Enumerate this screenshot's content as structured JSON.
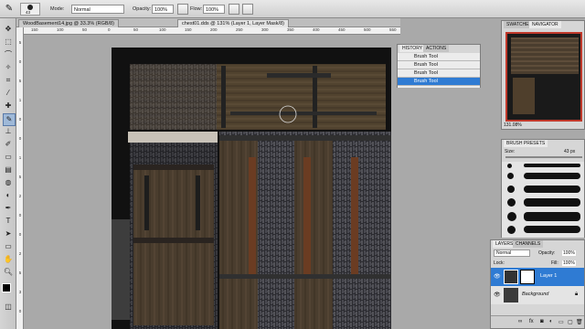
{
  "options": {
    "mode_label": "Mode:",
    "mode_value": "Normal",
    "opacity_label": "Opacity:",
    "opacity_value": "100%",
    "flow_label": "Flow:",
    "flow_value": "100%",
    "brush_size": "43"
  },
  "tabs": [
    {
      "label": "WoodBasement14.jpg @ 33.3% (RGB/8)"
    },
    {
      "label": "chest01.dds @ 131% (Layer 1, Layer Mask/8)"
    }
  ],
  "ruler_top": [
    "150",
    "100",
    "50",
    "0",
    "50",
    "100",
    "150",
    "200",
    "250",
    "300",
    "350",
    "400",
    "450",
    "500",
    "550"
  ],
  "ruler_left": [
    "5",
    "0",
    "5",
    "1",
    "0",
    "0",
    "1",
    "5",
    "2",
    "0",
    "0",
    "2",
    "5",
    "3",
    "0"
  ],
  "history": {
    "tabs": [
      "HISTORY",
      "ACTIONS"
    ],
    "items": [
      "Brush Tool",
      "Brush Tool",
      "Brush Tool",
      "Brush Tool"
    ],
    "selected_index": 3
  },
  "navigator": {
    "tabs": [
      "SWATCHES",
      "NAVIGATOR"
    ],
    "zoom": "131.08%"
  },
  "brush_presets": {
    "tab": "BRUSH PRESETS",
    "size_label": "Size:",
    "size_value": "43 px",
    "numbers": [
      "",
      "",
      "",
      "",
      "",
      "",
      "",
      ""
    ]
  },
  "layers": {
    "tabs": [
      "LAYERS",
      "CHANNELS"
    ],
    "blend_mode": "Normal",
    "opacity_label": "Opacity:",
    "opacity_value": "100%",
    "lock_label": "Lock:",
    "fill_label": "Fill:",
    "fill_value": "100%",
    "items": [
      {
        "name": "Layer 1",
        "selected": true
      },
      {
        "name": "Background",
        "selected": false
      }
    ]
  },
  "colors": {
    "accent": "#2f7bd3",
    "panel_bg": "#d6d6d6",
    "workspace": "#a9a9a9"
  }
}
